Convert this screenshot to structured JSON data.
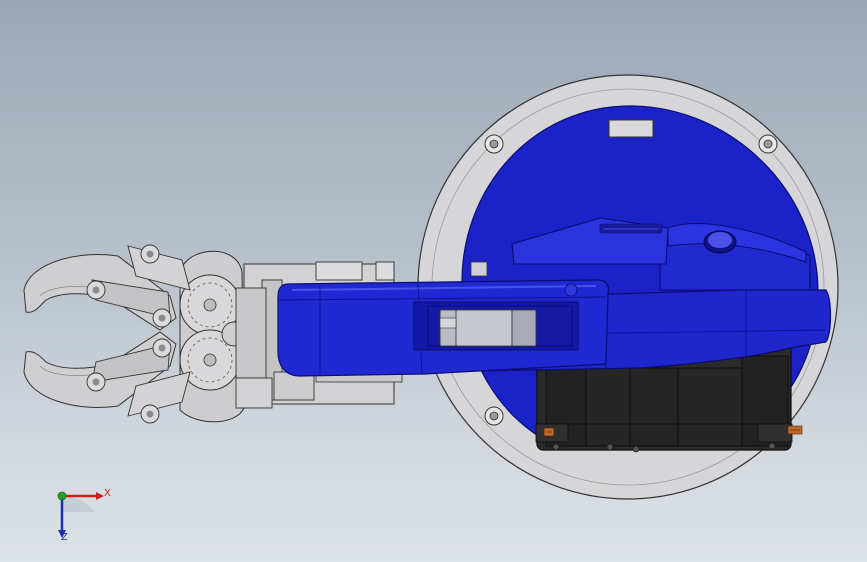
{
  "viewport": {
    "background_top": "#9ba7b6",
    "background_bottom": "#dde2e6"
  },
  "model": {
    "body_color": "#1a1fc4",
    "body_dark_color": "#0f13a0",
    "base_flange_color": "#d4d4d6",
    "gripper_color": "#cfcfd1",
    "servo_color": "#262626"
  },
  "triad": {
    "x_label": "X",
    "z_label": "Z",
    "x_color": "#cc2020",
    "y_color": "#2aa02a",
    "z_color": "#1a2fb0"
  }
}
